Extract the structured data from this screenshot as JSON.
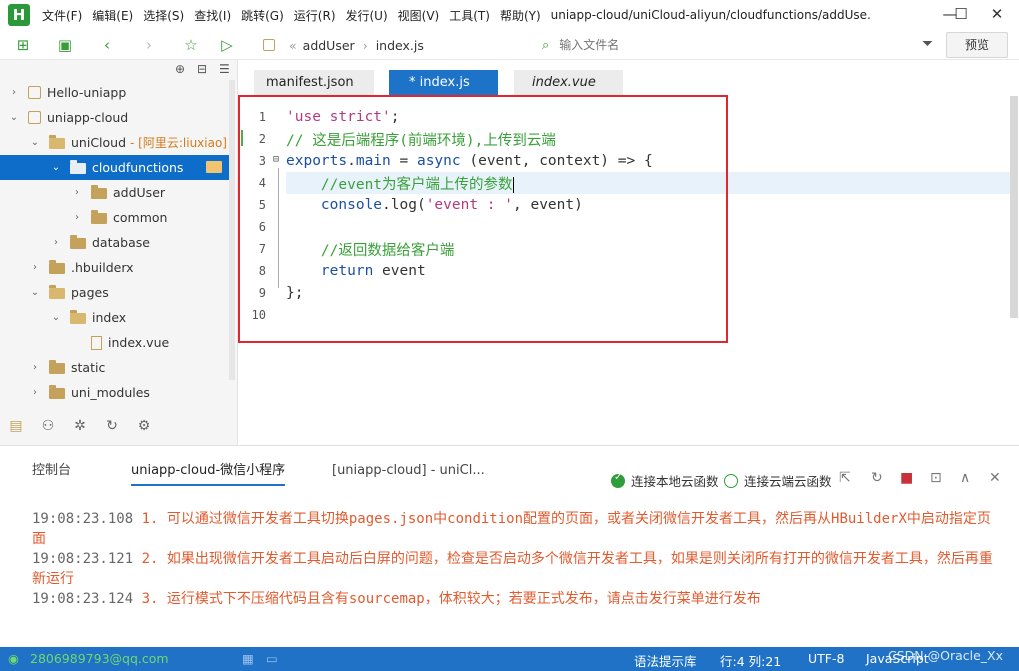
{
  "window": {
    "logo": "H",
    "menus": [
      "文件(F)",
      "编辑(E)",
      "选择(S)",
      "查找(I)",
      "跳转(G)",
      "运行(R)",
      "发行(U)",
      "视图(V)",
      "工具(T)",
      "帮助(Y)"
    ],
    "title": "uniapp-cloud/uniCloud-aliyun/cloudfunctions/addUse...",
    "controls": {
      "minimize": "—",
      "maximize": "☐",
      "close": "✕"
    }
  },
  "toolbar": {
    "breadcrumb": [
      "addUser",
      "index.js"
    ],
    "breadcrumb_sep": "«",
    "file_search_placeholder": "输入文件名",
    "preview_label": "预览"
  },
  "sidebar": {
    "tree": [
      {
        "label": "Hello-uniapp",
        "depth": 0,
        "caret": "›",
        "icon": "project"
      },
      {
        "label": "uniapp-cloud",
        "depth": 0,
        "caret": "⌄",
        "icon": "project"
      },
      {
        "label": "uniCloud",
        "tag": "- [阿里云:liuxiao]",
        "depth": 1,
        "caret": "⌄",
        "icon": "folder-open"
      },
      {
        "label": "cloudfunctions",
        "depth": 2,
        "caret": "⌄",
        "icon": "folder-white",
        "selected": true
      },
      {
        "label": "addUser",
        "depth": 3,
        "caret": "›",
        "icon": "folder"
      },
      {
        "label": "common",
        "depth": 3,
        "caret": "›",
        "icon": "folder"
      },
      {
        "label": "database",
        "depth": 2,
        "caret": "›",
        "icon": "folder"
      },
      {
        "label": ".hbuilderx",
        "depth": 1,
        "caret": "›",
        "icon": "folder"
      },
      {
        "label": "pages",
        "depth": 1,
        "caret": "⌄",
        "icon": "folder-open"
      },
      {
        "label": "index",
        "depth": 2,
        "caret": "⌄",
        "icon": "folder-open"
      },
      {
        "label": "index.vue",
        "depth": 3,
        "caret": "",
        "icon": "file-vue"
      },
      {
        "label": "static",
        "depth": 1,
        "caret": "›",
        "icon": "folder"
      },
      {
        "label": "uni_modules",
        "depth": 1,
        "caret": "›",
        "icon": "folder"
      }
    ]
  },
  "editor": {
    "tabs": [
      {
        "label": "manifest.json",
        "active": false,
        "italic": false
      },
      {
        "label": "* index.js",
        "active": true,
        "italic": false
      },
      {
        "label": "index.vue",
        "active": false,
        "italic": true
      }
    ],
    "lines": [
      {
        "n": "1",
        "tokens": [
          {
            "t": "'use strict'",
            "c": "str"
          },
          {
            "t": ";",
            "c": "plain"
          }
        ]
      },
      {
        "n": "2",
        "tokens": [
          {
            "t": "// 这是后端程序(前端环境),上传到云端",
            "c": "com"
          }
        ]
      },
      {
        "n": "3",
        "fold": "⊟",
        "tokens": [
          {
            "t": "exports",
            "c": "kw"
          },
          {
            "t": ".",
            "c": "plain"
          },
          {
            "t": "main",
            "c": "kw"
          },
          {
            "t": " = ",
            "c": "plain"
          },
          {
            "t": "async",
            "c": "kw"
          },
          {
            "t": " (event, context) => {",
            "c": "plain"
          }
        ]
      },
      {
        "n": "4",
        "current": true,
        "tokens": [
          {
            "t": "    //event为客户端上传的参数",
            "c": "com"
          }
        ]
      },
      {
        "n": "5",
        "tokens": [
          {
            "t": "    console",
            "c": "kw"
          },
          {
            "t": ".log(",
            "c": "plain"
          },
          {
            "t": "'event : '",
            "c": "str"
          },
          {
            "t": ", event)",
            "c": "plain"
          }
        ]
      },
      {
        "n": "6",
        "tokens": []
      },
      {
        "n": "7",
        "tokens": [
          {
            "t": "    //返回数据给客户端",
            "c": "com"
          }
        ]
      },
      {
        "n": "8",
        "tokens": [
          {
            "t": "    return",
            "c": "kw"
          },
          {
            "t": " event",
            "c": "plain"
          }
        ]
      },
      {
        "n": "9",
        "tokens": [
          {
            "t": "};",
            "c": "plain"
          }
        ]
      },
      {
        "n": "10",
        "tokens": []
      }
    ]
  },
  "console": {
    "tabs": [
      "控制台",
      "uniapp-cloud-微信小程序",
      "[uniapp-cloud] - uniCl..."
    ],
    "active_tab": 1,
    "radio_local": "连接本地云函数",
    "radio_cloud": "连接云端云函数",
    "logs": [
      {
        "time": "19:08:23.108",
        "text": " 1. 可以通过微信开发者工具切换pages.json中condition配置的页面，或者关闭微信开发者工具，然后再从HBuilderX中启动指定页面"
      },
      {
        "time": "19:08:23.121",
        "text": " 2. 如果出现微信开发者工具启动后白屏的问题，检查是否启动多个微信开发者工具，如果是则关闭所有打开的微信开发者工具，然后再重新运行"
      },
      {
        "time": "19:08:23.124",
        "text": " 3. 运行模式下不压缩代码且含有sourcemap，体积较大；若要正式发布，请点击发行菜单进行发布"
      }
    ]
  },
  "statusbar": {
    "email": "2806989793@qq.com",
    "syntax": "语法提示库",
    "position": "行:4  列:21",
    "encoding": "UTF-8",
    "language": "JavaScript",
    "watermark": "CSDN @Oracle_Xx"
  }
}
